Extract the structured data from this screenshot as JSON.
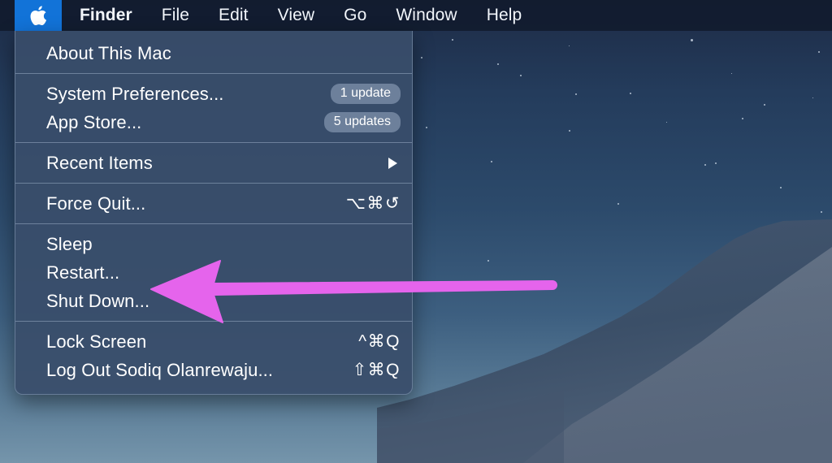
{
  "menubar": {
    "apple_icon": "apple-logo-icon",
    "items": [
      {
        "label": "Finder",
        "bold": true
      },
      {
        "label": "File",
        "bold": false
      },
      {
        "label": "Edit",
        "bold": false
      },
      {
        "label": "View",
        "bold": false
      },
      {
        "label": "Go",
        "bold": false
      },
      {
        "label": "Window",
        "bold": false
      },
      {
        "label": "Help",
        "bold": false
      }
    ]
  },
  "apple_menu": {
    "groups": [
      {
        "items": [
          {
            "label": "About This Mac",
            "shortcut": "",
            "badge": "",
            "submenu": false
          }
        ]
      },
      {
        "items": [
          {
            "label": "System Preferences...",
            "shortcut": "",
            "badge": "1 update",
            "submenu": false
          },
          {
            "label": "App Store...",
            "shortcut": "",
            "badge": "5 updates",
            "submenu": false
          }
        ]
      },
      {
        "items": [
          {
            "label": "Recent Items",
            "shortcut": "",
            "badge": "",
            "submenu": true
          }
        ]
      },
      {
        "items": [
          {
            "label": "Force Quit...",
            "shortcut": "⌥⌘↺",
            "badge": "",
            "submenu": false
          }
        ]
      },
      {
        "items": [
          {
            "label": "Sleep",
            "shortcut": "",
            "badge": "",
            "submenu": false
          },
          {
            "label": "Restart...",
            "shortcut": "",
            "badge": "",
            "submenu": false
          },
          {
            "label": "Shut Down...",
            "shortcut": "",
            "badge": "",
            "submenu": false
          }
        ]
      },
      {
        "items": [
          {
            "label": "Lock Screen",
            "shortcut": "^⌘Q",
            "badge": "",
            "submenu": false
          },
          {
            "label": "Log Out Sodiq Olanrewaju...",
            "shortcut": "⇧⌘Q",
            "badge": "",
            "submenu": false
          }
        ]
      }
    ]
  },
  "annotation": {
    "arrow_color": "#e564ec",
    "points_at": "Restart..."
  },
  "colors": {
    "menubar_bg": "#111a2c",
    "apple_highlight": "#1273d8",
    "menu_panel_bg": "#394d6b",
    "badge_bg": "#8ea0ba",
    "text": "#ffffff",
    "arrow": "#e564ec"
  }
}
